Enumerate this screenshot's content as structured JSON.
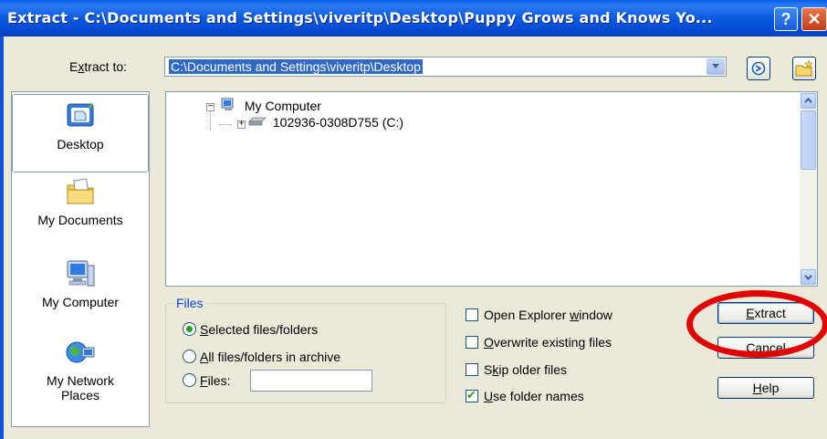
{
  "window": {
    "title": "Extract - C:\\Documents and Settings\\viveritp\\Desktop\\Puppy Grows and Knows Yo...",
    "help_glyph": "?",
    "close_glyph": "✕"
  },
  "extract_to": {
    "label_prefix": "E",
    "label_underlined": "x",
    "label_suffix": "tract to:",
    "value": "C:\\Documents and Settings\\viveritp\\Desktop"
  },
  "places": [
    {
      "label": "Desktop",
      "icon": "desktop-icon"
    },
    {
      "label": "My Documents",
      "icon": "my-documents-icon"
    },
    {
      "label": "My Computer",
      "icon": "my-computer-icon"
    },
    {
      "label": "My Network Places",
      "icon": "my-network-places-icon"
    }
  ],
  "tree": {
    "root": "My Computer",
    "drive": "102936-0308D755 (C:)"
  },
  "files": {
    "legend": "Files",
    "options": [
      {
        "u": "S",
        "rest": "elected files/folders",
        "checked": true
      },
      {
        "u": "A",
        "rest": "ll files/folders in archive",
        "checked": false
      },
      {
        "u": "F",
        "rest": "iles:",
        "checked": false
      }
    ],
    "files_value": ""
  },
  "options": [
    {
      "pre": "Open Explorer ",
      "u": "w",
      "rest": "indow",
      "checked": false
    },
    {
      "pre": "",
      "u": "O",
      "rest": "verwrite existing files",
      "checked": false
    },
    {
      "pre": "S",
      "u": "k",
      "rest": "ip older files",
      "checked": false
    },
    {
      "pre": "",
      "u": "U",
      "rest": "se folder names",
      "checked": true
    }
  ],
  "buttons": {
    "extract": {
      "u": "E",
      "rest": "xtract"
    },
    "cancel": "Cancel",
    "help": {
      "u": "H",
      "rest": "elp"
    }
  },
  "colors": {
    "title_bar": "#0a5ae0",
    "dialog_bg": "#ece9d8",
    "selection": "#316ac5",
    "annotation_ring": "#e00000",
    "legend_text": "#0046d5"
  }
}
